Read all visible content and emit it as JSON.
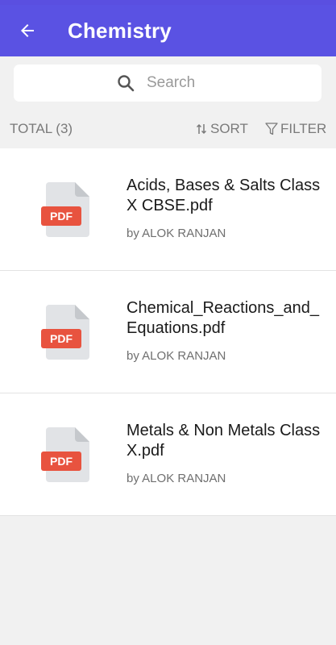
{
  "appbar": {
    "title": "Chemistry",
    "color": "#5a52e3"
  },
  "search": {
    "placeholder": "Search"
  },
  "toolbar": {
    "total_label": "TOTAL (3)",
    "sort_label": "SORT",
    "filter_label": "FILTER"
  },
  "files": [
    {
      "title": "Acids, Bases & Salts Class X CBSE.pdf",
      "author": "by ALOK RANJAN",
      "icon": "pdf-file-icon",
      "badge": "PDF"
    },
    {
      "title": "Chemical_Reactions_and_ Equations.pdf",
      "author": "by ALOK RANJAN",
      "icon": "pdf-file-icon",
      "badge": "PDF"
    },
    {
      "title": "Metals & Non Metals Class X.pdf",
      "author": "by ALOK RANJAN",
      "icon": "pdf-file-icon",
      "badge": "PDF"
    }
  ],
  "colors": {
    "pdf_badge": "#e8533f",
    "pdf_page": "#e1e3e6",
    "background": "#f1f1f1"
  }
}
